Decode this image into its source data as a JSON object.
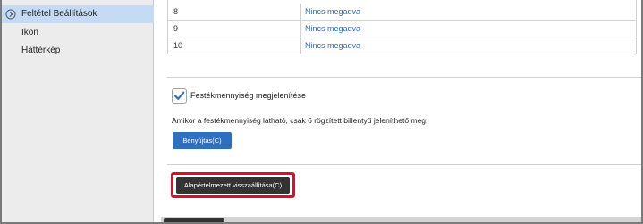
{
  "sidebar": {
    "items": [
      {
        "label": "Feltétel Beállítások",
        "active": true,
        "icon": "chevron-right-circle-icon"
      },
      {
        "label": "Ikon",
        "active": false
      },
      {
        "label": "Háttérkép",
        "active": false
      }
    ]
  },
  "table": {
    "rows": [
      {
        "num": "8",
        "value": "Nincs megadva"
      },
      {
        "num": "9",
        "value": "Nincs megadva"
      },
      {
        "num": "10",
        "value": "Nincs megadva"
      }
    ]
  },
  "settings": {
    "checkbox_label": "Festékmennyiség megjelenítése",
    "checkbox_checked": true,
    "note": "Amikor a festékmennyiség látható, csak 6 rögzített billentyű jeleníthető meg.",
    "apply_label": "Benyújtás(C)",
    "reset_label": "Alapértelmezett visszaállítása(C)"
  },
  "colors": {
    "accent": "#2f6fbf",
    "link": "#2b6fc9",
    "highlight": "#d8102b",
    "sidebar_active": "#c5daf5"
  }
}
